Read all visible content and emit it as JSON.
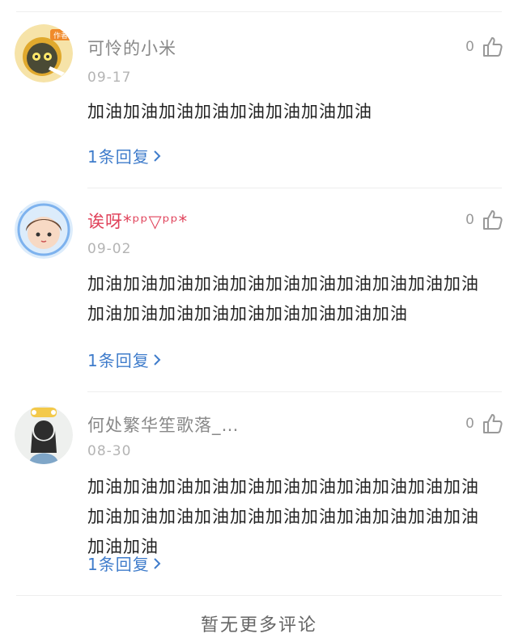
{
  "comments": [
    {
      "author": "可怜的小米",
      "author_badge": "作者",
      "date": "09-17",
      "likes": "0",
      "content": "加油加油加油加油加油加油加油加油",
      "reply_label": "1条回复",
      "avatar_icon": "anime-avatar-author"
    },
    {
      "author": "诶呀*ᵖᵖ▽ᵖᵖ*",
      "date": "09-02",
      "likes": "0",
      "content": "加油加油加油加油加油加油加油加油加油加油加油加油加油加油加油加油加油加油加油加油",
      "reply_label": "1条回复",
      "avatar_icon": "anime-girl-avatar"
    },
    {
      "author": "何处繁华笙歌落_…",
      "date": "08-30",
      "likes": "0",
      "content": "加油加油加油加油加油加油加油加油加油加油加油加油加油加油加油加油加油加油加油加油加油加油加油加油",
      "reply_label": "1条回复",
      "avatar_icon": "girl-photo-avatar"
    }
  ],
  "footer": {
    "text": "暂无更多评论"
  },
  "colors": {
    "name_default": "#888888",
    "name_highlight": "#e0435b",
    "link": "#3f7ccb",
    "divider": "#eeeeee"
  }
}
